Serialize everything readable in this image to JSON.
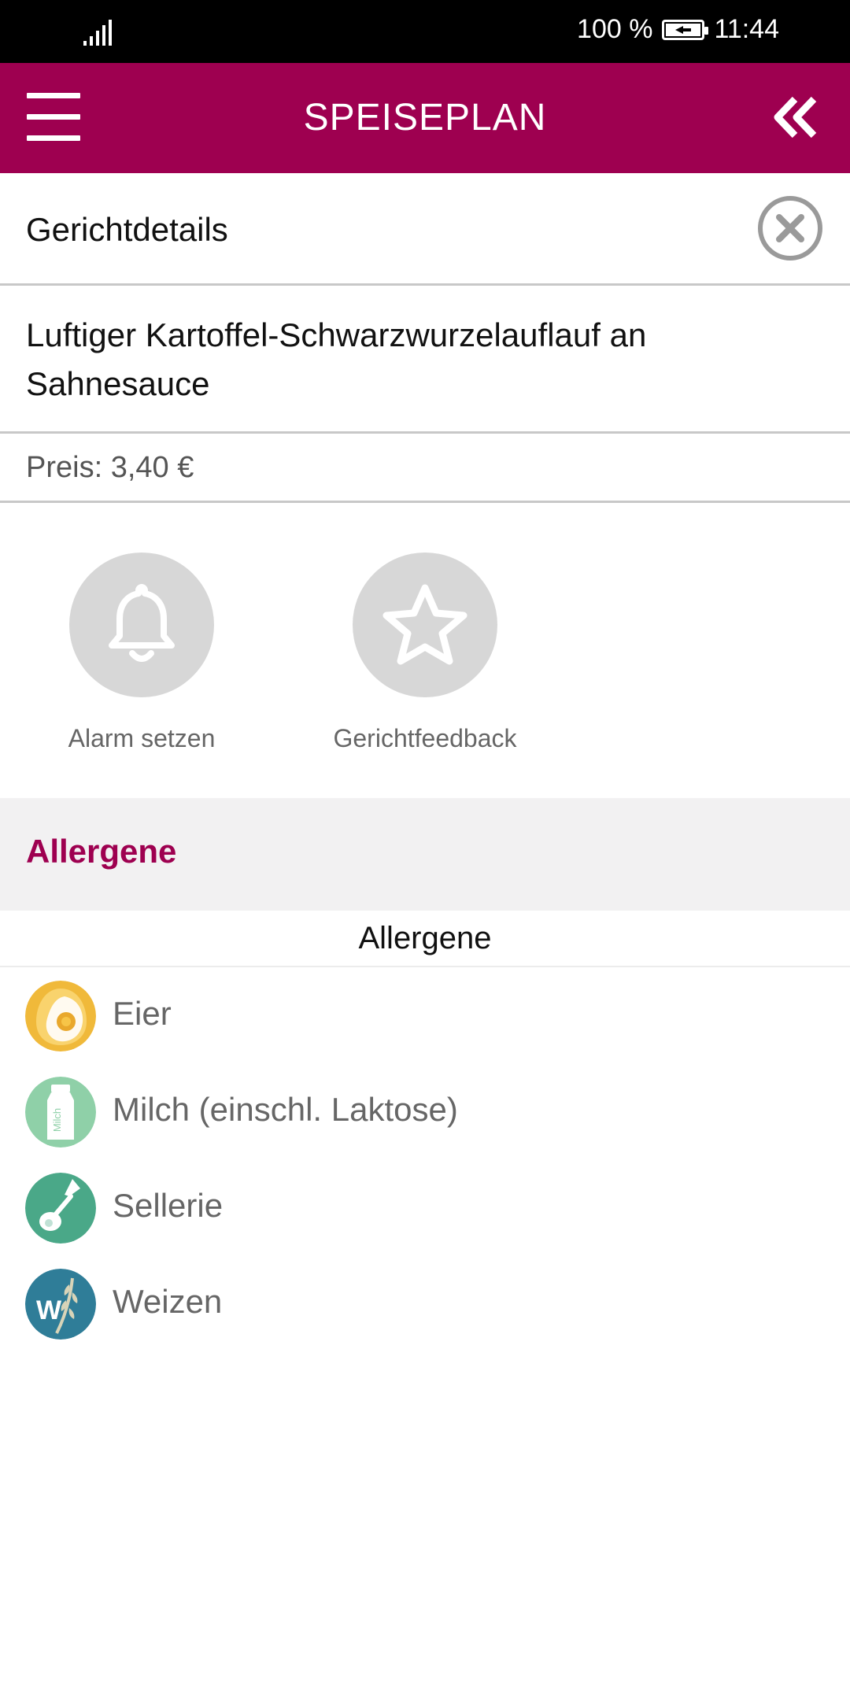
{
  "status_bar": {
    "battery_percent": "100 %",
    "time": "11:44",
    "icons": [
      "signal-icon",
      "battery-charging-icon"
    ]
  },
  "app_bar": {
    "title": "SPEISEPLAN",
    "menu_icon": "hamburger-menu-icon",
    "back_icon": "double-chevron-left-icon"
  },
  "details": {
    "title": "Gerichtdetails",
    "close_icon": "close-circle-icon"
  },
  "dish": {
    "name": "Luftiger Kartoffel-Schwarzwurzelauflauf an Sahnesauce",
    "price": "Preis: 3,40 €"
  },
  "actions": [
    {
      "label": "Alarm setzen",
      "icon": "bell-icon"
    },
    {
      "label": "Gerichtfeedback",
      "icon": "star-icon"
    }
  ],
  "allergens": {
    "section_title": "Allergene",
    "subheader": "Allergene",
    "items": [
      {
        "name": "Eier",
        "icon": "egg-icon",
        "color": "#f0b93a"
      },
      {
        "name": "Milch (einschl. Laktose)",
        "icon": "milk-bottle-icon",
        "color": "#8fd0a8",
        "icon_text": "Milch"
      },
      {
        "name": "Sellerie",
        "icon": "celery-icon",
        "color": "#4aa888"
      },
      {
        "name": "Weizen",
        "icon": "wheat-icon",
        "color": "#2f7d98",
        "icon_text": "W"
      }
    ]
  },
  "colors": {
    "brand": "#9e0050",
    "section_background": "#f2f1f2",
    "action_circle": "#d7d7d7"
  }
}
